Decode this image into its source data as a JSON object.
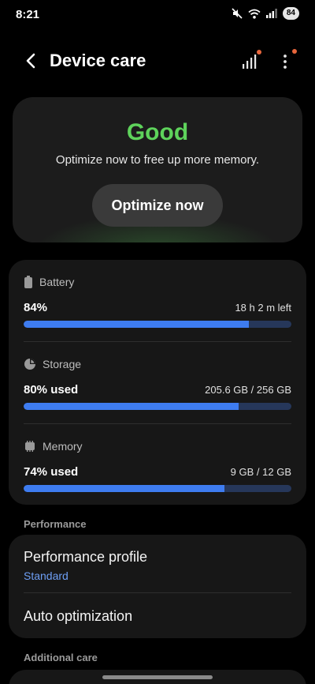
{
  "status_bar": {
    "time": "8:21",
    "battery": "84"
  },
  "app_bar": {
    "title": "Device care"
  },
  "hero": {
    "status": "Good",
    "description": "Optimize now to free up more memory.",
    "button_label": "Optimize now",
    "status_color": "#5ed35b"
  },
  "resources": {
    "battery": {
      "label": "Battery",
      "value": "84%",
      "detail": "18 h 2 m left",
      "level": 0.84
    },
    "storage": {
      "label": "Storage",
      "value": "80% used",
      "detail": "205.6 GB / 256 GB",
      "level": 0.803
    },
    "memory": {
      "label": "Memory",
      "value": "74% used",
      "detail": "9 GB / 12 GB",
      "level": 0.75
    },
    "bar_color": "#3e7cf0",
    "track_color": "#26375a"
  },
  "performance": {
    "section_label": "Performance",
    "profile_title": "Performance profile",
    "profile_value": "Standard",
    "auto_title": "Auto optimization"
  },
  "additional": {
    "section_label": "Additional care"
  }
}
